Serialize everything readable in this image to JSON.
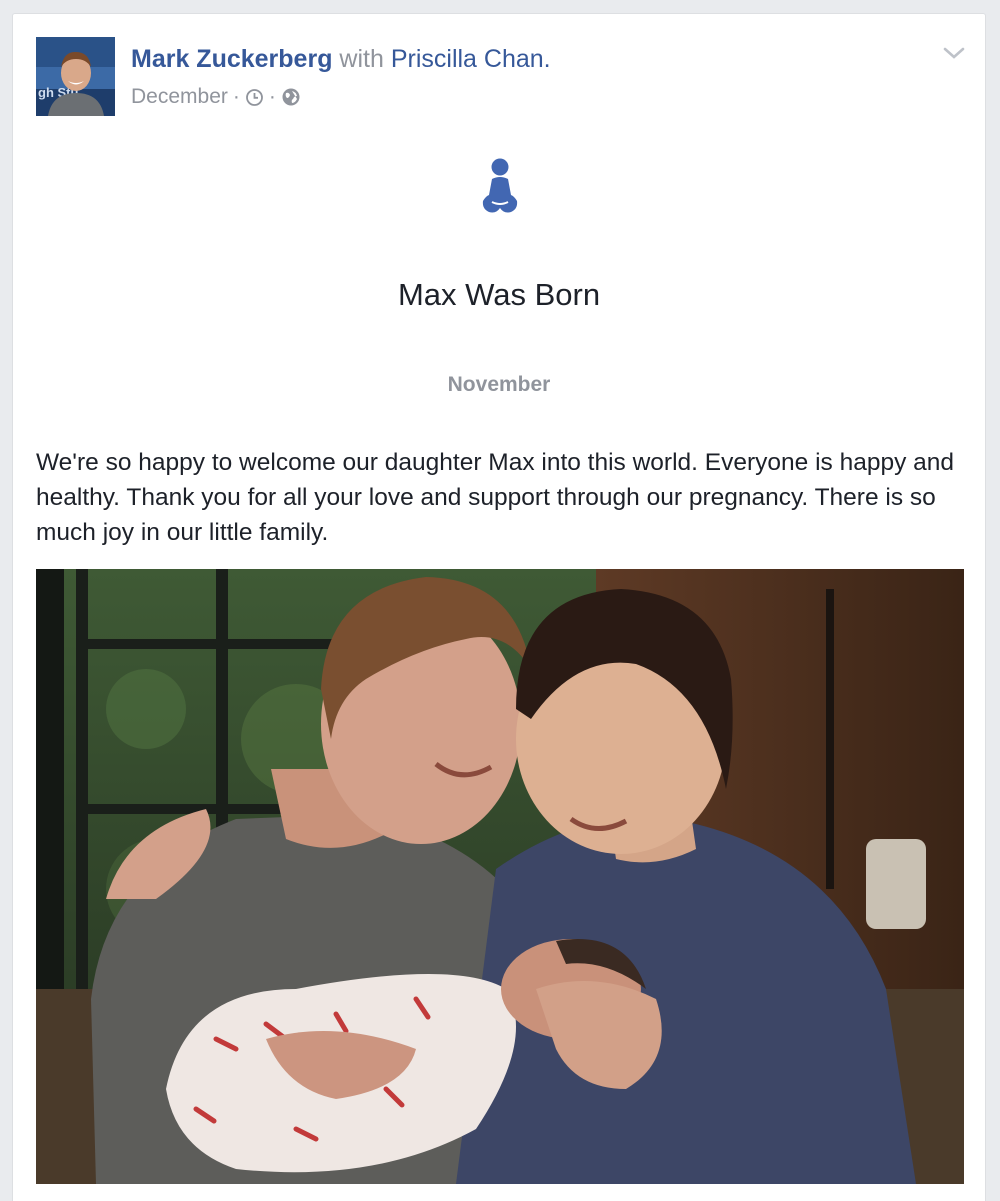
{
  "post": {
    "author": "Mark Zuckerberg",
    "with_text": "with",
    "tagged_person": "Priscilla Chan.",
    "date": "December",
    "separator": "·",
    "clock_icon": "clock-icon",
    "audience_icon": "globe-icon",
    "menu_icon": "chevron-down-icon",
    "avatar_text": "gh Stu",
    "life_event": {
      "icon": "baby-icon",
      "title": "Max Was Born",
      "date": "November"
    },
    "text": "We're so happy to welcome our daughter Max into this world. Everyone is happy and healthy. Thank you for all your love and support through our pregnancy. There is so much joy in our little family."
  },
  "colors": {
    "link": "#365899",
    "muted": "#90949c",
    "text": "#1d2129",
    "page_background": "#e9ebee",
    "icon_blue": "#4267b2"
  }
}
